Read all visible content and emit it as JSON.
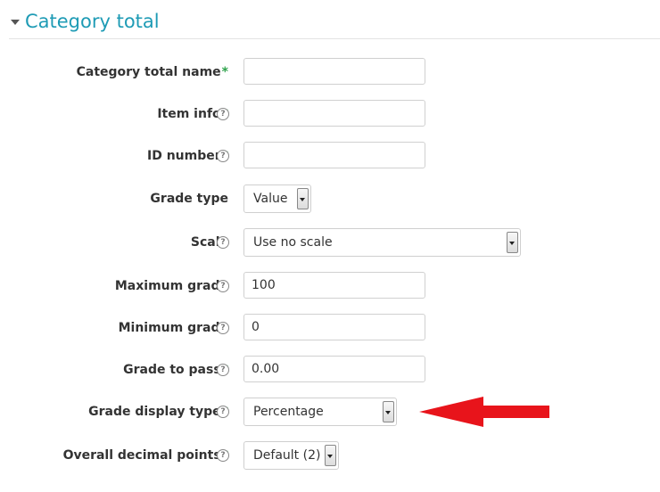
{
  "section": {
    "title": "Category total"
  },
  "fields": [
    {
      "label": "Category total name",
      "required": "*",
      "value": ""
    },
    {
      "label": "Item info",
      "required": "*",
      "value": ""
    },
    {
      "label": "ID number",
      "required": "*",
      "value": ""
    },
    {
      "label": "Grade type",
      "required": "",
      "selected": "Value"
    },
    {
      "label": "Scale",
      "required": "",
      "selected": "Use no scale"
    },
    {
      "label": "Maximum grade",
      "required": "",
      "value": "100"
    },
    {
      "label": "Minimum grade",
      "required": "",
      "value": "0"
    },
    {
      "label": "Grade to pass",
      "required": "*",
      "value": "0.00"
    },
    {
      "label": "Grade display type",
      "required": "*",
      "selected": "Percentage"
    },
    {
      "label": "Overall decimal points",
      "required": "*",
      "selected": "Default (2)"
    }
  ],
  "help_icon_glyph": "?",
  "colors": {
    "accent": "#1e9bb5",
    "required": "#2fa34c",
    "annotation_arrow": "#e8141b"
  }
}
